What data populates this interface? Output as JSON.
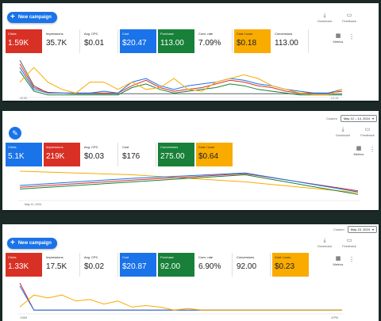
{
  "panels": [
    {
      "new_campaign": "New campaign",
      "download": "Download",
      "feedback": "Feedback",
      "metrics_label": "Metrics",
      "x_start": "12,24",
      "x_end": "1,1,11",
      "cards": [
        {
          "label": "Clicks",
          "value": "1.59K",
          "color": "red"
        },
        {
          "label": "Impressions",
          "value": "35.7K",
          "color": "none"
        },
        {
          "label": "Avg. CPC",
          "value": "$0.01",
          "color": "none"
        },
        {
          "label": "Cost",
          "value": "$20.47",
          "color": "blue"
        },
        {
          "label": "Purchase",
          "value": "113.00",
          "color": "green"
        },
        {
          "label": "Conv. rate",
          "value": "7.09%",
          "color": "none"
        },
        {
          "label": "Cost / conv.",
          "value": "$0.18",
          "color": "orange"
        },
        {
          "label": "Conversions",
          "value": "113.00",
          "color": "none"
        }
      ]
    },
    {
      "date_prefix": "Custom",
      "date_range": "May 12 – 14, 2024",
      "download": "Download",
      "feedback": "Feedback",
      "metrics_label": "Metrics",
      "x_start": "May 12, 2024",
      "cards": [
        {
          "label": "Clicks",
          "value": "5.1K",
          "color": "blue"
        },
        {
          "label": "Impressions",
          "value": "219K",
          "color": "red"
        },
        {
          "label": "Avg. CPC",
          "value": "$0.03",
          "color": "none"
        },
        {
          "label": "Cost",
          "value": "$176",
          "color": "none"
        },
        {
          "label": "Conversions",
          "value": "275.00",
          "color": "green"
        },
        {
          "label": "Cost / conv.",
          "value": "$0.64",
          "color": "orange"
        }
      ]
    },
    {
      "new_campaign": "New campaign",
      "date_prefix": "Custom",
      "date_range": "May 15, 2024",
      "download": "Download",
      "feedback": "Feedback",
      "metrics_label": "Metrics",
      "x_start": "12AM",
      "x_end": "11PM",
      "cards": [
        {
          "label": "Clicks",
          "value": "1.33K",
          "color": "red"
        },
        {
          "label": "Impressions",
          "value": "17.5K",
          "color": "none"
        },
        {
          "label": "Avg. CPC",
          "value": "$0.02",
          "color": "none"
        },
        {
          "label": "Cost",
          "value": "$20.87",
          "color": "blue"
        },
        {
          "label": "Purchase",
          "value": "92.00",
          "color": "green"
        },
        {
          "label": "Conv. rate",
          "value": "6.90%",
          "color": "none"
        },
        {
          "label": "Conversions",
          "value": "92.00",
          "color": "none"
        },
        {
          "label": "Cost / conv.",
          "value": "$0.23",
          "color": "orange"
        }
      ]
    }
  ],
  "line_colors": {
    "red": "#d93025",
    "blue": "#1a73e8",
    "green": "#188038",
    "orange": "#f9ab00",
    "gray": "#5f6368"
  },
  "chart_data": [
    {
      "type": "line",
      "series": [
        {
          "color": "#5f6368",
          "values": [
            10,
            3,
            1,
            1,
            0.8,
            0.8,
            0.8,
            0.8,
            0.8,
            0.8,
            0.8,
            0.8,
            0.8,
            0.8,
            0.8,
            0.8,
            0.8,
            0.8,
            0.8,
            0.8,
            0.8,
            0.8,
            0.8,
            0.8
          ]
        },
        {
          "color": "#d93025",
          "values": [
            9,
            2.5,
            1.2,
            1,
            1,
            1,
            1,
            1,
            3,
            4.5,
            2.5,
            1.5,
            2,
            2.5,
            3.5,
            4.5,
            4,
            3,
            2.5,
            1.5,
            1,
            1,
            1,
            1.5
          ]
        },
        {
          "color": "#1a73e8",
          "values": [
            8,
            2,
            1,
            1,
            1,
            1,
            1.5,
            1,
            4,
            5,
            3,
            2,
            3,
            3.5,
            4,
            5,
            4.5,
            3.5,
            3,
            2,
            1.5,
            1,
            1,
            2
          ]
        },
        {
          "color": "#188038",
          "values": [
            7,
            1.5,
            0.5,
            0.5,
            0.5,
            0.5,
            0.5,
            0.5,
            2.5,
            3.5,
            2,
            1,
            1.5,
            2,
            2.5,
            3.5,
            3,
            2,
            1.5,
            1,
            0.5,
            0.5,
            0.5,
            0.5
          ]
        },
        {
          "color": "#f9ab00",
          "values": [
            4,
            8,
            4,
            2,
            1,
            4,
            4,
            2,
            4,
            2,
            2.5,
            5,
            2,
            1.5,
            4,
            5,
            6,
            5,
            3,
            2,
            1,
            0.5,
            0.5,
            2
          ]
        }
      ]
    },
    {
      "type": "line",
      "series": [
        {
          "color": "#f9ab00",
          "values": [
            8,
            7,
            5,
            2
          ]
        },
        {
          "color": "#188038",
          "values": [
            3,
            5,
            7,
            1.5
          ]
        },
        {
          "color": "#d93025",
          "values": [
            3.5,
            5.5,
            7.3,
            2.5
          ]
        },
        {
          "color": "#1a73e8",
          "values": [
            4,
            6,
            7.5,
            2.2
          ]
        }
      ]
    },
    {
      "type": "line",
      "series": [
        {
          "color": "#d93025",
          "values": [
            10,
            1,
            1,
            1,
            1,
            1,
            1,
            1,
            1,
            1,
            1,
            1,
            1,
            1,
            1,
            1,
            1,
            1,
            1,
            1,
            1,
            1,
            1,
            1
          ]
        },
        {
          "color": "#1a73e8",
          "values": [
            9,
            1,
            1,
            1,
            1,
            1,
            1,
            1,
            1,
            1,
            1,
            1,
            1,
            1,
            1,
            1,
            1,
            1,
            1,
            1,
            1,
            1,
            1,
            1
          ]
        },
        {
          "color": "#f9ab00",
          "values": [
            2,
            6,
            5,
            6,
            4,
            4.5,
            3,
            4,
            2,
            2.5,
            2,
            1,
            1.5,
            1,
            1,
            1,
            1,
            1,
            1,
            1,
            1,
            1,
            1,
            1
          ]
        }
      ]
    }
  ]
}
